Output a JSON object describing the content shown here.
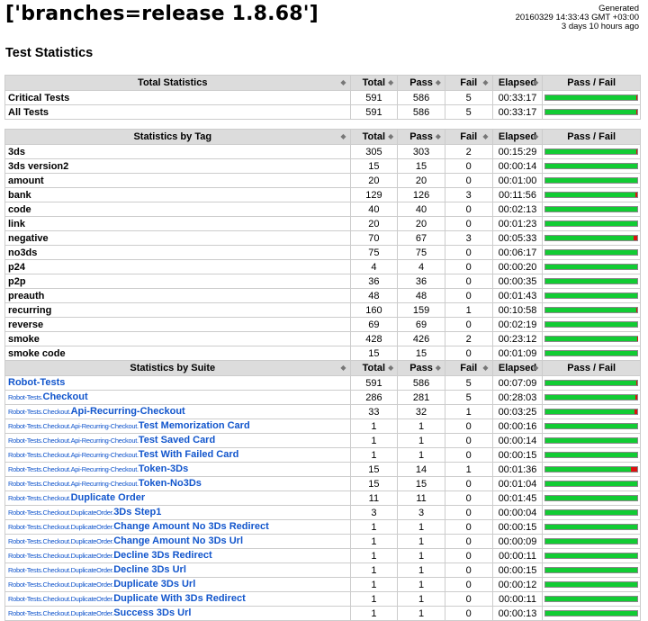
{
  "header": {
    "title": "['branches=release 1.8.68']",
    "generated_label": "Generated",
    "generated_time": "20160329 14:33:43 GMT +03:00",
    "generated_ago": "3 days 10 hours ago",
    "section_title": "Test Statistics"
  },
  "columns": {
    "total": "Total",
    "pass": "Pass",
    "fail": "Fail",
    "elapsed": "Elapsed",
    "passfail": "Pass / Fail"
  },
  "colors": {
    "pass": "#11cc33",
    "fail": "#dd1111",
    "header_bg": "#dcdcdc",
    "link": "#1155cc"
  },
  "total_stats": {
    "heading": "Total Statistics",
    "rows": [
      {
        "name": "Critical Tests",
        "total": "591",
        "pass": "586",
        "fail": "5",
        "elapsed": "00:33:17"
      },
      {
        "name": "All Tests",
        "total": "591",
        "pass": "586",
        "fail": "5",
        "elapsed": "00:33:17"
      }
    ]
  },
  "tag_stats": {
    "heading": "Statistics by Tag",
    "rows": [
      {
        "name": "3ds",
        "total": "305",
        "pass": "303",
        "fail": "2",
        "elapsed": "00:15:29"
      },
      {
        "name": "3ds version2",
        "total": "15",
        "pass": "15",
        "fail": "0",
        "elapsed": "00:00:14"
      },
      {
        "name": "amount",
        "total": "20",
        "pass": "20",
        "fail": "0",
        "elapsed": "00:01:00"
      },
      {
        "name": "bank",
        "total": "129",
        "pass": "126",
        "fail": "3",
        "elapsed": "00:11:56"
      },
      {
        "name": "code",
        "total": "40",
        "pass": "40",
        "fail": "0",
        "elapsed": "00:02:13"
      },
      {
        "name": "link",
        "total": "20",
        "pass": "20",
        "fail": "0",
        "elapsed": "00:01:23"
      },
      {
        "name": "negative",
        "total": "70",
        "pass": "67",
        "fail": "3",
        "elapsed": "00:05:33"
      },
      {
        "name": "no3ds",
        "total": "75",
        "pass": "75",
        "fail": "0",
        "elapsed": "00:06:17"
      },
      {
        "name": "p24",
        "total": "4",
        "pass": "4",
        "fail": "0",
        "elapsed": "00:00:20"
      },
      {
        "name": "p2p",
        "total": "36",
        "pass": "36",
        "fail": "0",
        "elapsed": "00:00:35"
      },
      {
        "name": "preauth",
        "total": "48",
        "pass": "48",
        "fail": "0",
        "elapsed": "00:01:43"
      },
      {
        "name": "recurring",
        "total": "160",
        "pass": "159",
        "fail": "1",
        "elapsed": "00:10:58"
      },
      {
        "name": "reverse",
        "total": "69",
        "pass": "69",
        "fail": "0",
        "elapsed": "00:02:19"
      },
      {
        "name": "smoke",
        "total": "428",
        "pass": "426",
        "fail": "2",
        "elapsed": "00:23:12"
      },
      {
        "name": "smoke code",
        "total": "15",
        "pass": "15",
        "fail": "0",
        "elapsed": "00:01:09"
      }
    ]
  },
  "suite_stats": {
    "heading": "Statistics by Suite",
    "rows": [
      {
        "parent": "",
        "name": "Robot-Tests",
        "total": "591",
        "pass": "586",
        "fail": "5",
        "elapsed": "00:07:09"
      },
      {
        "parent": "Robot-Tests.",
        "name": "Checkout",
        "total": "286",
        "pass": "281",
        "fail": "5",
        "elapsed": "00:28:03"
      },
      {
        "parent": "Robot-Tests.Checkout.",
        "name": "Api-Recurring-Checkout",
        "total": "33",
        "pass": "32",
        "fail": "1",
        "elapsed": "00:03:25"
      },
      {
        "parent": "Robot-Tests.Checkout.Api-Recurring-Checkout.",
        "name": "Test Memorization Card",
        "total": "1",
        "pass": "1",
        "fail": "0",
        "elapsed": "00:00:16"
      },
      {
        "parent": "Robot-Tests.Checkout.Api-Recurring-Checkout.",
        "name": "Test Saved Card",
        "total": "1",
        "pass": "1",
        "fail": "0",
        "elapsed": "00:00:14"
      },
      {
        "parent": "Robot-Tests.Checkout.Api-Recurring-Checkout.",
        "name": "Test With Failed Card",
        "total": "1",
        "pass": "1",
        "fail": "0",
        "elapsed": "00:00:15"
      },
      {
        "parent": "Robot-Tests.Checkout.Api-Recurring-Checkout.",
        "name": "Token-3Ds",
        "total": "15",
        "pass": "14",
        "fail": "1",
        "elapsed": "00:01:36"
      },
      {
        "parent": "Robot-Tests.Checkout.Api-Recurring-Checkout.",
        "name": "Token-No3Ds",
        "total": "15",
        "pass": "15",
        "fail": "0",
        "elapsed": "00:01:04"
      },
      {
        "parent": "Robot-Tests.Checkout.",
        "name": "Duplicate Order",
        "total": "11",
        "pass": "11",
        "fail": "0",
        "elapsed": "00:01:45"
      },
      {
        "parent": "Robot-Tests.Checkout.DuplicateOrder.",
        "name": "3Ds Step1",
        "total": "3",
        "pass": "3",
        "fail": "0",
        "elapsed": "00:00:04"
      },
      {
        "parent": "Robot-Tests.Checkout.DuplicateOrder.",
        "name": "Change Amount No 3Ds Redirect",
        "total": "1",
        "pass": "1",
        "fail": "0",
        "elapsed": "00:00:15"
      },
      {
        "parent": "Robot-Tests.Checkout.DuplicateOrder.",
        "name": "Change Amount No 3Ds Url",
        "total": "1",
        "pass": "1",
        "fail": "0",
        "elapsed": "00:00:09"
      },
      {
        "parent": "Robot-Tests.Checkout.DuplicateOrder.",
        "name": "Decline 3Ds Redirect",
        "total": "1",
        "pass": "1",
        "fail": "0",
        "elapsed": "00:00:11"
      },
      {
        "parent": "Robot-Tests.Checkout.DuplicateOrder.",
        "name": "Decline 3Ds Url",
        "total": "1",
        "pass": "1",
        "fail": "0",
        "elapsed": "00:00:15"
      },
      {
        "parent": "Robot-Tests.Checkout.DuplicateOrder.",
        "name": "Duplicate 3Ds Url",
        "total": "1",
        "pass": "1",
        "fail": "0",
        "elapsed": "00:00:12"
      },
      {
        "parent": "Robot-Tests.Checkout.DuplicateOrder.",
        "name": "Duplicate With 3Ds Redirect",
        "total": "1",
        "pass": "1",
        "fail": "0",
        "elapsed": "00:00:11"
      },
      {
        "parent": "Robot-Tests.Checkout.DuplicateOrder.",
        "name": "Success 3Ds Url",
        "total": "1",
        "pass": "1",
        "fail": "0",
        "elapsed": "00:00:13"
      }
    ]
  }
}
